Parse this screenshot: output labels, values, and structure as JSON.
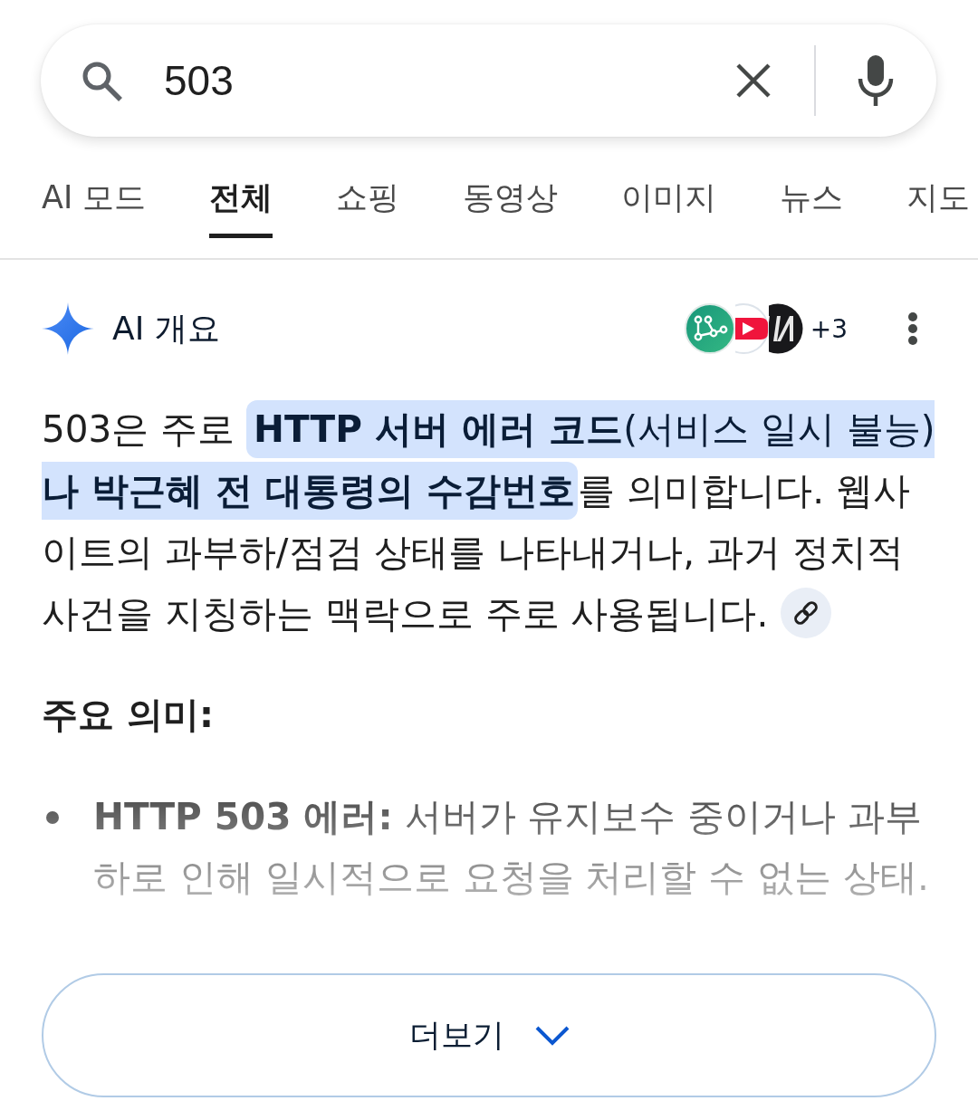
{
  "search": {
    "value": "503"
  },
  "tabs": [
    {
      "label": "AI 모드",
      "selected": false
    },
    {
      "label": "전체",
      "selected": true
    },
    {
      "label": "쇼핑",
      "selected": false
    },
    {
      "label": "동영상",
      "selected": false
    },
    {
      "label": "이미지",
      "selected": false
    },
    {
      "label": "뉴스",
      "selected": false
    },
    {
      "label": "지도",
      "selected": false
    }
  ],
  "ai_overview": {
    "title": "AI 개요",
    "sources": [
      {
        "kind": "graph"
      },
      {
        "kind": "video"
      },
      {
        "kind": "logo"
      }
    ],
    "source_count": "+3"
  },
  "summary": {
    "before": "503은 주로 ",
    "highlight": "**HTTP 서버 에러 코드**(서비스 일시 불능)**나 박근혜 전 대통령의 수감번호**",
    "after": "를 의미합니다. 웹사이트의 과부하/점검 상태를 나타내거나, 과거 정치적 사건을 지칭하는 맥락으로 주로 사용됩니다."
  },
  "section_heading": "주요 의미:",
  "bullets": [
    {
      "text": "**HTTP 503 에러:** 서버가 유지보수 중이거나 과부하로 인해 일시적으로 요청을 처리할 수 없는 상태."
    }
  ],
  "more_button": {
    "label": "더보기"
  }
}
